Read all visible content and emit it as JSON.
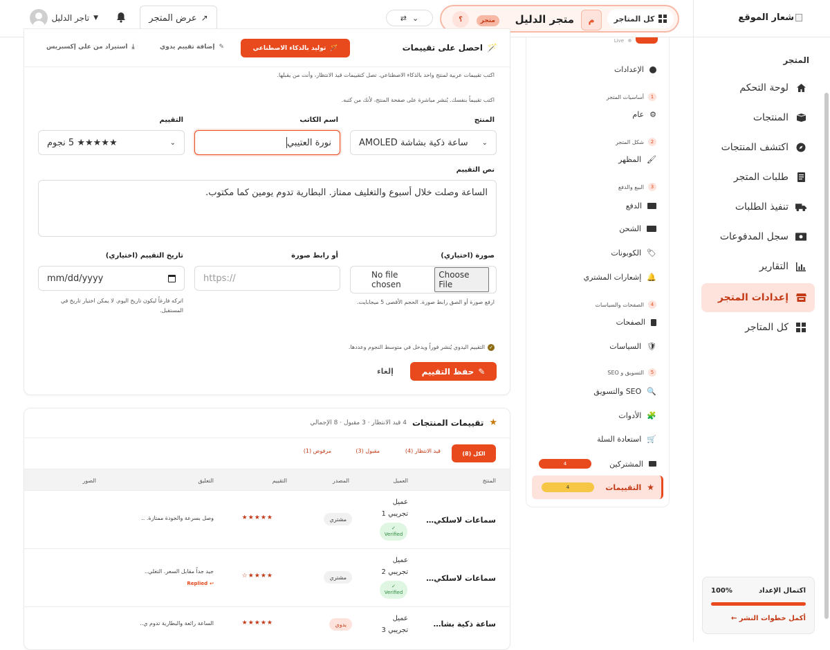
{
  "header": {
    "all_stores_label": "كل المتاجر",
    "store_initial": "م",
    "store_name": "متجر الدليل",
    "store_badge": "متجر",
    "help_label": "؟",
    "view_store_label": "عرض المتجر",
    "user_name": "تاجر الدليل",
    "logo_text": "شعار الموقع"
  },
  "sidebar": {
    "section_title": "المتجر",
    "items": [
      {
        "label": "لوحة التحكم",
        "icon": "home-icon"
      },
      {
        "label": "المنتجات",
        "icon": "box-icon"
      },
      {
        "label": "اكتشف المنتجات",
        "icon": "compass-icon"
      },
      {
        "label": "طلبات المتجر",
        "icon": "receipt-icon"
      },
      {
        "label": "تنفيذ الطلبات",
        "icon": "truck-icon"
      },
      {
        "label": "سجل المدفوعات",
        "icon": "money-icon"
      },
      {
        "label": "التقارير",
        "icon": "chart-icon"
      },
      {
        "label": "إعدادات المتجر",
        "icon": "store-icon",
        "active": true
      },
      {
        "label": "كل المتاجر",
        "icon": "grid-icon"
      }
    ],
    "setup_title": "اكتمال الإعداد",
    "setup_percent": "100%",
    "setup_progress": 1.0,
    "setup_link": "أكمل خطوات النشر ←"
  },
  "settings": {
    "live_label": "Live",
    "settings_label": "الإعدادات",
    "groups": [
      {
        "num": "1",
        "title": "أساسيات المتجر",
        "items": [
          {
            "label": "عام"
          }
        ]
      },
      {
        "num": "2",
        "title": "شكل المتجر",
        "items": [
          {
            "label": "المظهر"
          }
        ]
      },
      {
        "num": "3",
        "title": "البيع والدفع",
        "items": [
          {
            "label": "الدفع"
          },
          {
            "label": "الشحن"
          },
          {
            "label": "الكوبونات"
          },
          {
            "label": "إشعارات المشتري"
          }
        ]
      },
      {
        "num": "4",
        "title": "الصفحات والسياسات",
        "items": [
          {
            "label": "الصفحات"
          },
          {
            "label": "السياسات"
          }
        ]
      },
      {
        "num": "5",
        "title": "التسويق و SEO",
        "items": [
          {
            "label": "SEO والتسويق"
          },
          {
            "label": "الأدوات"
          },
          {
            "label": "استعادة السلة"
          },
          {
            "label": "المشتركين",
            "badge": "4"
          },
          {
            "label": "التقييمات",
            "badge": "4",
            "active": true
          }
        ]
      }
    ]
  },
  "review_form": {
    "title": "احصل على تقييمات",
    "ai_button": "توليد بالذكاء الاصطناعي",
    "manual_button": "إضافة تقييم يدوي",
    "import_button": "استيراد من علي إكسبريس",
    "ai_note": "اكتب تقييمات عربية لمنتج واحد بالذكاء الاصطناعي. تصل كتقييمات قيد الانتظار، وأنت من يقبلها.",
    "manual_note": "اكتب تقييماً بنفسك. يُنشر مباشرة على صفحة المنتج، لأنك من كتبه.",
    "product_label": "المنتج",
    "product_value": "ساعة ذكية بشاشة AMOLED",
    "author_label": "اسم الكاتب",
    "author_value": "نورة العتيبي",
    "rating_label": "التقييم",
    "rating_value": "★★★★★ 5 نجوم",
    "text_label": "نص التقييم",
    "text_value": "الساعة وصلت خلال أسبوع والتغليف ممتاز. البطارية تدوم يومين كما مكتوب.",
    "image_label": "صورة (اختياري)",
    "choose_file": "Choose File",
    "no_file": "No file chosen",
    "image_note": "ارفع صورة أو الصق رابط صورة. الحجم الأقصى 5 ميجابايت.",
    "image_url_label": "أو رابط صورة",
    "image_url_placeholder": "https://",
    "date_label": "تاريخ التقييم (اختياري)",
    "date_placeholder": "mm/dd/yyyy",
    "date_note": "اتركه فارغاً ليكون تاريخ اليوم. لا يمكن اختيار تاريخ في المستقبل.",
    "info_note": "التقييم اليدوي يُنشر فوراً ويدخل في متوسط النجوم وعددها.",
    "save_button": "حفظ التقييم",
    "cancel_button": "إلغاء"
  },
  "reviews": {
    "title": "تقييمات المنتجات",
    "summary": "4 قيد الانتظار · 3 مقبول · 8 الإجمالي",
    "tabs": [
      "الكل (8)",
      "قيد الانتظار (4)",
      "مقبول (3)",
      "مرفوض (1)"
    ],
    "columns": [
      "المنتج",
      "العميل",
      "المصدر",
      "التقييم",
      "التعليق",
      "الصور"
    ],
    "rows": [
      {
        "product": "سماعات لاسلكي…",
        "customer": [
          "عميل",
          "تجريبي 1"
        ],
        "verified": "Verified",
        "source": "مشتري",
        "stars": "★★★★★",
        "comment": "وصل بسرعة والجودة ممتازة. ..",
        "replied": ""
      },
      {
        "product": "سماعات لاسلكي…",
        "customer": [
          "عميل",
          "تجريبي 2"
        ],
        "verified": "Verified",
        "source": "مشتري",
        "stars": "★★★★☆",
        "comment": "جيد جداً مقابل السعر. التغلي..",
        "replied": "Replied"
      },
      {
        "product": "ساعة ذكية بشا…",
        "customer": [
          "عميل",
          "تجريبي 3"
        ],
        "verified": "",
        "source": "يدوي",
        "stars": "★★★★★",
        "comment": "الساعة رائعة والبطارية تدوم ي..",
        "replied": ""
      }
    ]
  },
  "colors": {
    "accent": "#e8491d",
    "accent_light": "#fde3dc",
    "badge_yellow": "#f6c744",
    "success": "#2e8b3f"
  }
}
